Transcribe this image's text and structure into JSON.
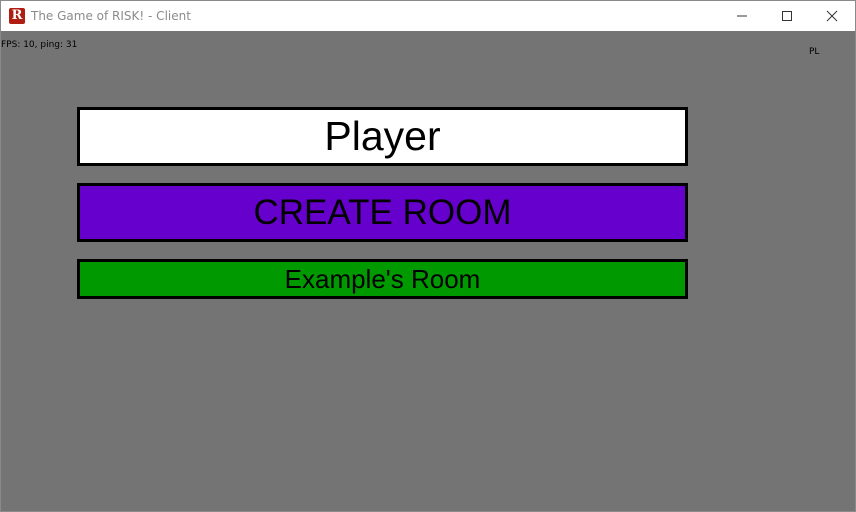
{
  "window": {
    "title": "The Game of RISK! - Client",
    "icon": "risk-app-icon",
    "icon_letter": "R"
  },
  "hud": {
    "fps_text": "FPS: 10, ping: 31",
    "language": "PL"
  },
  "menu": {
    "player_name": "Player",
    "create_room_label": "CREATE ROOM",
    "rooms": [
      {
        "label": "Example's Room"
      }
    ]
  },
  "colors": {
    "background": "#747474",
    "player_box": "#ffffff",
    "create_room": "#6600cc",
    "room": "#009900"
  }
}
